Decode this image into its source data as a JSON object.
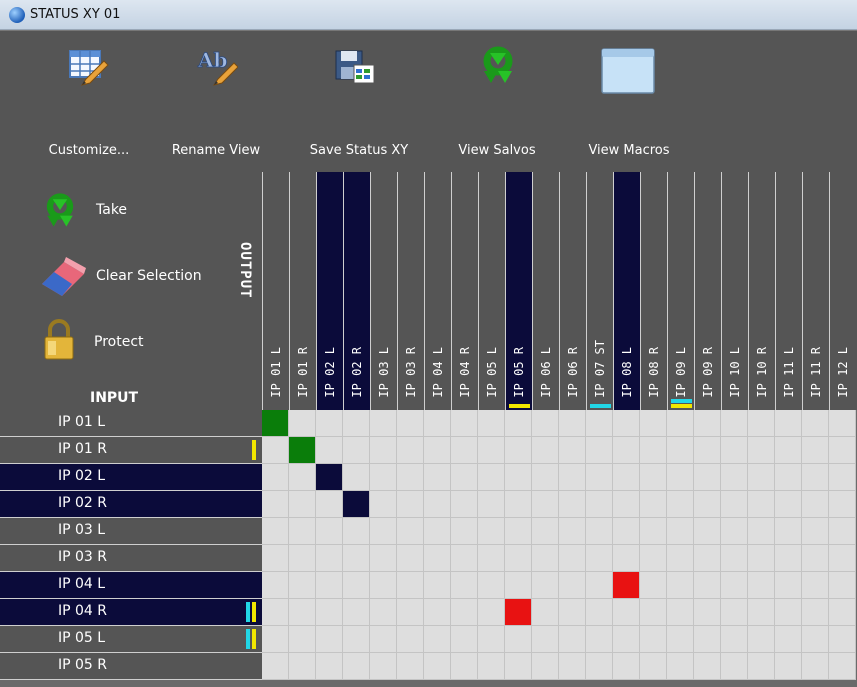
{
  "window": {
    "title": "STATUS XY 01"
  },
  "toolbar": [
    {
      "label": "Customize...",
      "icon": "customize-table-icon"
    },
    {
      "label": "Rename View",
      "icon": "rename-icon"
    },
    {
      "label": "Save Status XY",
      "icon": "save-icon"
    },
    {
      "label": "View Salvos",
      "icon": "salvo-icon"
    },
    {
      "label": "View Macros",
      "icon": "window-icon"
    }
  ],
  "panel": {
    "take": "Take",
    "clear": "Clear Selection",
    "protect": "Protect",
    "output_label": "OUTPUT",
    "input_label": "INPUT"
  },
  "columns": [
    {
      "label": "IP 01 L",
      "selected": false,
      "markers": []
    },
    {
      "label": "IP 01 R",
      "selected": false,
      "markers": []
    },
    {
      "label": "IP 02 L",
      "selected": true,
      "markers": []
    },
    {
      "label": "IP 02 R",
      "selected": true,
      "markers": []
    },
    {
      "label": "IP 03 L",
      "selected": false,
      "markers": []
    },
    {
      "label": "IP 03 R",
      "selected": false,
      "markers": []
    },
    {
      "label": "IP 04 L",
      "selected": false,
      "markers": []
    },
    {
      "label": "IP 04 R",
      "selected": false,
      "markers": []
    },
    {
      "label": "IP 05 L",
      "selected": false,
      "markers": []
    },
    {
      "label": "IP 05 R",
      "selected": true,
      "markers": [
        "#f2e600"
      ]
    },
    {
      "label": "IP 06 L",
      "selected": false,
      "markers": []
    },
    {
      "label": "IP 06 R",
      "selected": false,
      "markers": []
    },
    {
      "label": "IP 07 ST",
      "selected": false,
      "markers": [
        "#22d6e6"
      ]
    },
    {
      "label": "IP 08 L",
      "selected": true,
      "markers": []
    },
    {
      "label": "IP 08 R",
      "selected": false,
      "markers": []
    },
    {
      "label": "IP 09 L",
      "selected": false,
      "markers": [
        "#22d6e6",
        "#f2e600"
      ]
    },
    {
      "label": "IP 09 R",
      "selected": false,
      "markers": []
    },
    {
      "label": "IP 10 L",
      "selected": false,
      "markers": []
    },
    {
      "label": "IP 10 R",
      "selected": false,
      "markers": []
    },
    {
      "label": "IP 11 L",
      "selected": false,
      "markers": []
    },
    {
      "label": "IP 11 R",
      "selected": false,
      "markers": []
    },
    {
      "label": "IP 12 L",
      "selected": false,
      "markers": []
    }
  ],
  "rows": [
    {
      "label": "IP 01 L",
      "selected": false,
      "markers": []
    },
    {
      "label": "IP 01 R",
      "selected": false,
      "markers": [
        "#f2e600"
      ]
    },
    {
      "label": "IP 02 L",
      "selected": true,
      "markers": []
    },
    {
      "label": "IP 02 R",
      "selected": true,
      "markers": []
    },
    {
      "label": "IP 03 L",
      "selected": false,
      "markers": []
    },
    {
      "label": "IP 03 R",
      "selected": false,
      "markers": []
    },
    {
      "label": "IP 04 L",
      "selected": true,
      "markers": []
    },
    {
      "label": "IP 04 R",
      "selected": true,
      "markers": [
        "#22d6e6",
        "#f2e600"
      ]
    },
    {
      "label": "IP 05 L",
      "selected": false,
      "markers": [
        "#22d6e6",
        "#f2e600"
      ]
    },
    {
      "label": "IP 05 R",
      "selected": false,
      "markers": []
    }
  ],
  "crosspoints": [
    {
      "row": 0,
      "col": 0,
      "color": "#0a7d0a"
    },
    {
      "row": 1,
      "col": 1,
      "color": "#0a7d0a"
    },
    {
      "row": 2,
      "col": 2,
      "color": "#0b0b3a"
    },
    {
      "row": 3,
      "col": 3,
      "color": "#0b0b3a"
    },
    {
      "row": 6,
      "col": 13,
      "color": "#e81212"
    },
    {
      "row": 7,
      "col": 9,
      "color": "#e81212"
    }
  ]
}
